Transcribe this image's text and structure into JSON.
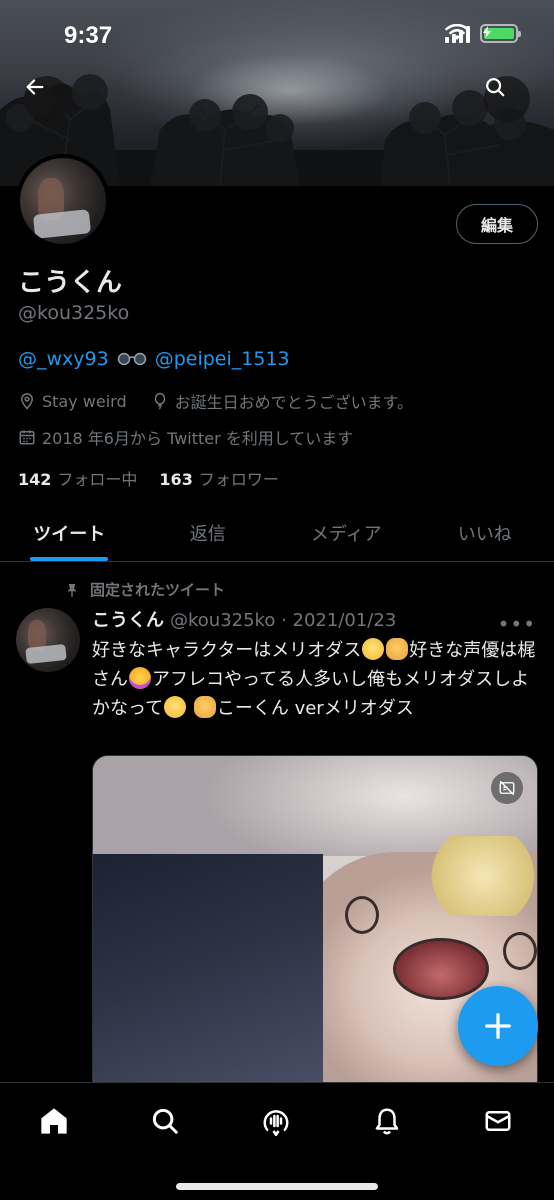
{
  "status_bar": {
    "time": "9:37"
  },
  "profile": {
    "name": "こうくん",
    "handle": "@kou325ko",
    "edit_label": "編集",
    "bio_link_1": "@_wxy93",
    "bio_link_2": "@peipei_1513",
    "location": "Stay weird",
    "birthday_text": "お誕生日おめでとうございます。",
    "joined": "2018 年6月から Twitter を利用しています",
    "following_count": "142",
    "following_label": "フォロー中",
    "followers_count": "163",
    "followers_label": "フォロワー"
  },
  "tabs": [
    {
      "label": "ツイート",
      "active": true
    },
    {
      "label": "返信",
      "active": false
    },
    {
      "label": "メディア",
      "active": false
    },
    {
      "label": "いいね",
      "active": false
    }
  ],
  "tweet": {
    "pinned_label": "固定されたツイート",
    "author_name": "こうくん",
    "author_handle_date": "@kou325ko · 2021/01/23",
    "text_part1": "好きなキャラクターはメリオダス",
    "text_part2": "好きな声優は梶さん",
    "text_part3": "アフレコやってる人多いし俺もメリオダスしよかなって",
    "text_part4": "こーくん verメリオダス"
  },
  "icons": {
    "back": "arrow-left-icon",
    "search": "search-icon",
    "location": "location-pin-icon",
    "balloon": "balloon-icon",
    "calendar": "calendar-icon",
    "pin": "pin-icon",
    "more": "more-horizontal-icon",
    "home": "home-icon",
    "explore": "search-icon",
    "spaces": "spaces-icon",
    "notifications": "bell-icon",
    "messages": "mail-icon",
    "compose": "plus-icon"
  },
  "colors": {
    "accent": "#1d9bf0",
    "background": "#000000",
    "muted": "#71767b",
    "text": "#e7e9ea"
  }
}
